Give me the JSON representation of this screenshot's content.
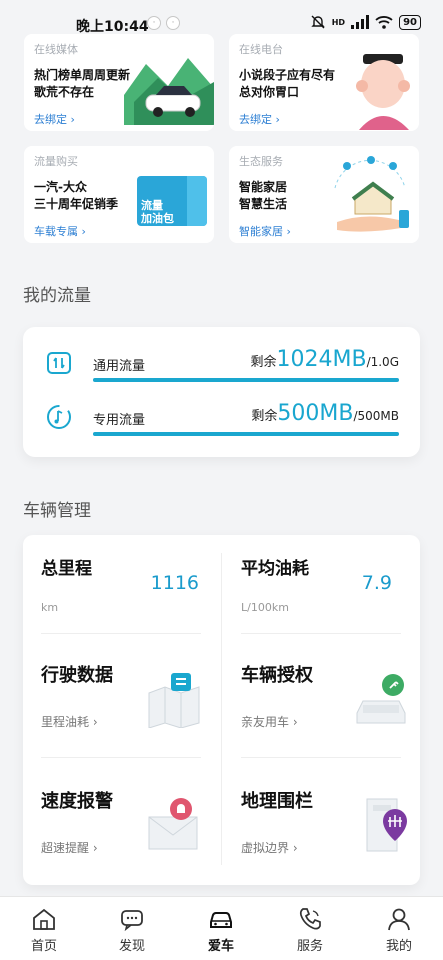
{
  "status_bar": {
    "time": "晚上10:44",
    "network": "HD",
    "battery": "90"
  },
  "service_cards": [
    {
      "tag": "在线媒体",
      "title1": "热门榜单周周更新",
      "title2": "歌荒不存在",
      "link": "去绑定"
    },
    {
      "tag": "在线电台",
      "title1": "小说段子应有尽有",
      "title2": "总对你胃口",
      "link": "去绑定"
    },
    {
      "tag": "流量购买",
      "title1": "一汽-大众",
      "title2": "三十周年促销季",
      "link": "车载专属",
      "badge1": "流量",
      "badge2": "加油包"
    },
    {
      "tag": "生态服务",
      "title1": "智能家居",
      "title2": "智慧生活",
      "link": "智能家居"
    }
  ],
  "my_traffic": {
    "section_title": "我的流量",
    "rows": [
      {
        "label": "通用流量",
        "remain_prefix": "剩余",
        "remain_value": "1024MB",
        "total": "/1.0G",
        "fill": 1.0
      },
      {
        "label": "专用流量",
        "remain_prefix": "剩余",
        "remain_value": "500MB",
        "total": "/500MB",
        "fill": 1.0
      }
    ]
  },
  "vehicle": {
    "section_title": "车辆管理",
    "mileage": {
      "label": "总里程",
      "value": "1116",
      "unit": "km"
    },
    "fuel": {
      "label": "平均油耗",
      "value": "7.9",
      "unit": "L/100km"
    },
    "features": [
      {
        "title": "行驶数据",
        "sub": "里程油耗"
      },
      {
        "title": "车辆授权",
        "sub": "亲友用车"
      },
      {
        "title": "速度报警",
        "sub": "超速提醒"
      },
      {
        "title": "地理围栏",
        "sub": "虚拟边界"
      }
    ]
  },
  "tabbar": [
    {
      "label": "首页",
      "icon": "home-icon"
    },
    {
      "label": "发现",
      "icon": "chat-icon"
    },
    {
      "label": "爱车",
      "icon": "car-icon"
    },
    {
      "label": "服务",
      "icon": "phone-icon"
    },
    {
      "label": "我的",
      "icon": "person-icon"
    }
  ],
  "colors": {
    "accent": "#1aa7cf",
    "link": "#2d7fd3",
    "background": "#f3f4f6"
  }
}
